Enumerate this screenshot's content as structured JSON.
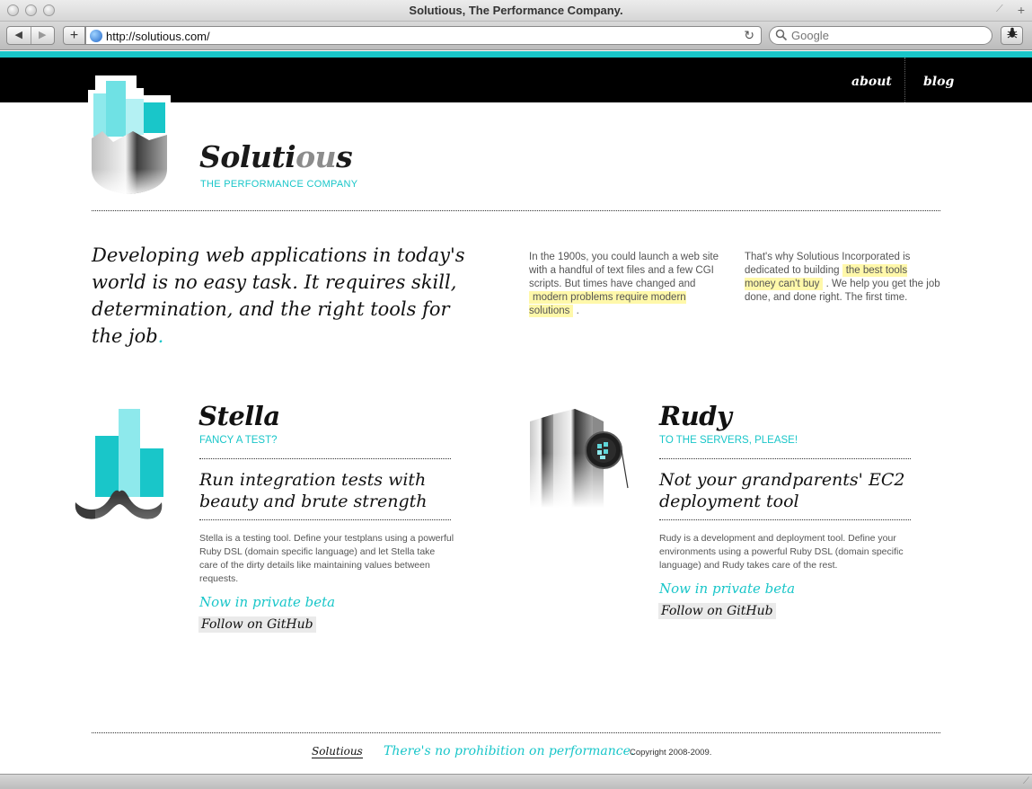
{
  "window": {
    "title": "Solutious, The Performance Company.",
    "url": "http://solutious.com/",
    "search_placeholder": "Google"
  },
  "nav": {
    "about": "about",
    "blog": "blog"
  },
  "brand": {
    "name_main": "Soluti",
    "name_accent": "ou",
    "name_end": "s",
    "tagline": "THE PERFORMANCE COMPANY"
  },
  "intro": {
    "heading": "Developing web applications in today's world is no easy task. It requires skill, determination, and the right tools for the job",
    "heading_dot": ".",
    "col1_text": "In the 1900s, you could launch a web site with a handful of text files and a few CGI scripts. But times have changed and",
    "col1_highlight": "modern problems require modern solutions",
    "col1_end": ".",
    "col2_text": "That's why Solutious Incorporated is dedicated to building",
    "col2_highlight": "the best tools money can't buy",
    "col2_end": ". We help you get the job done, and done right. The first time."
  },
  "products": [
    {
      "name": "Stella",
      "subtitle": "FANCY A TEST?",
      "headline": "Run integration tests with beauty and brute strength",
      "description": "Stella is a testing tool. Define your testplans using a powerful Ruby DSL (domain specific language) and let Stella take care of the dirty details like maintaining values between requests.",
      "beta": "Now in private beta",
      "github": "Follow on GitHub"
    },
    {
      "name": "Rudy",
      "subtitle": "TO THE SERVERS, PLEASE!",
      "headline": "Not your grandparents' EC2 deployment tool",
      "description": "Rudy is a development and deployment tool. Define your environments using a powerful Ruby DSL (domain specific language) and Rudy takes care of the rest.",
      "beta": "Now in private beta",
      "github": "Follow on GitHub"
    }
  ],
  "footer": {
    "brand": "Solutious",
    "dot": ".",
    "slogan": "There's no prohibition on performance.",
    "copyright": "Copyright 2008-2009."
  },
  "colors": {
    "accent": "#19c6c9",
    "highlight": "#fff8aa",
    "nav_bg": "#000000"
  }
}
